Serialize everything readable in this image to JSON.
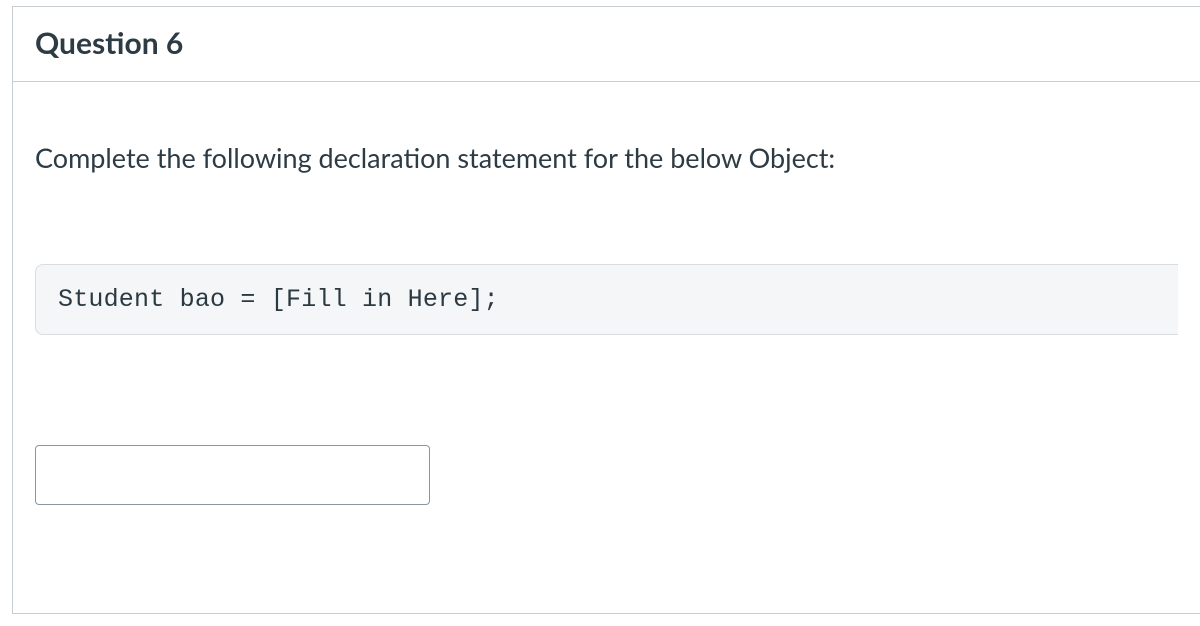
{
  "question": {
    "title": "Question 6",
    "prompt": "Complete the following declaration statement for the below Object:",
    "code": "Student bao = [Fill in Here];",
    "answer_value": "",
    "answer_placeholder": ""
  }
}
